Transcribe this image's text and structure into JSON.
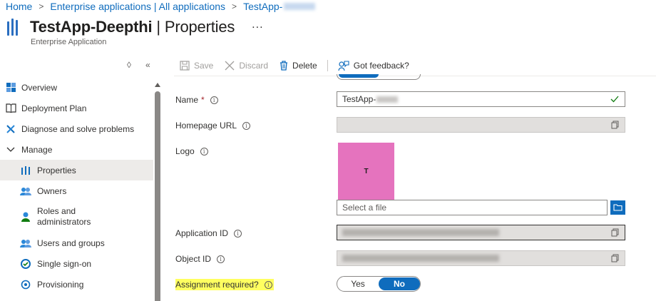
{
  "breadcrumb": {
    "home": "Home",
    "enterprise": "Enterprise applications | All applications",
    "app": "TestApp-"
  },
  "header": {
    "app_name": "TestApp-Deepthi",
    "separator": "|",
    "section": "Properties",
    "more": "...",
    "subtitle": "Enterprise Application"
  },
  "sidebar": {
    "items": [
      {
        "label": "Overview",
        "icon": "grid-icon"
      },
      {
        "label": "Deployment Plan",
        "icon": "book-icon"
      },
      {
        "label": "Diagnose and solve problems",
        "icon": "wrench-icon"
      },
      {
        "label": "Manage",
        "icon": "chevron-down-icon"
      },
      {
        "label": "Properties",
        "icon": "properties-icon"
      },
      {
        "label": "Owners",
        "icon": "users-icon"
      },
      {
        "label": "Roles and administrators",
        "icon": "person-icon"
      },
      {
        "label": "Users and groups",
        "icon": "users-icon"
      },
      {
        "label": "Single sign-on",
        "icon": "sso-icon"
      },
      {
        "label": "Provisioning",
        "icon": "provisioning-icon"
      }
    ]
  },
  "toolbar": {
    "save": "Save",
    "discard": "Discard",
    "delete": "Delete",
    "feedback": "Got feedback?"
  },
  "form": {
    "name_label": "Name",
    "name_required": "*",
    "name_value": "TestApp-",
    "homepage_label": "Homepage URL",
    "homepage_value": "",
    "logo_label": "Logo",
    "logo_letter": "T",
    "file_placeholder": "Select a file",
    "application_id_label": "Application ID",
    "object_id_label": "Object ID",
    "assignment_label": "Assignment required?",
    "toggle_yes": "Yes",
    "toggle_no": "No",
    "assignment_value": "No"
  },
  "colors": {
    "accent": "#0f6cbd",
    "logo_bg": "#e573be",
    "highlight": "#ffff60",
    "required": "#a4262c"
  }
}
